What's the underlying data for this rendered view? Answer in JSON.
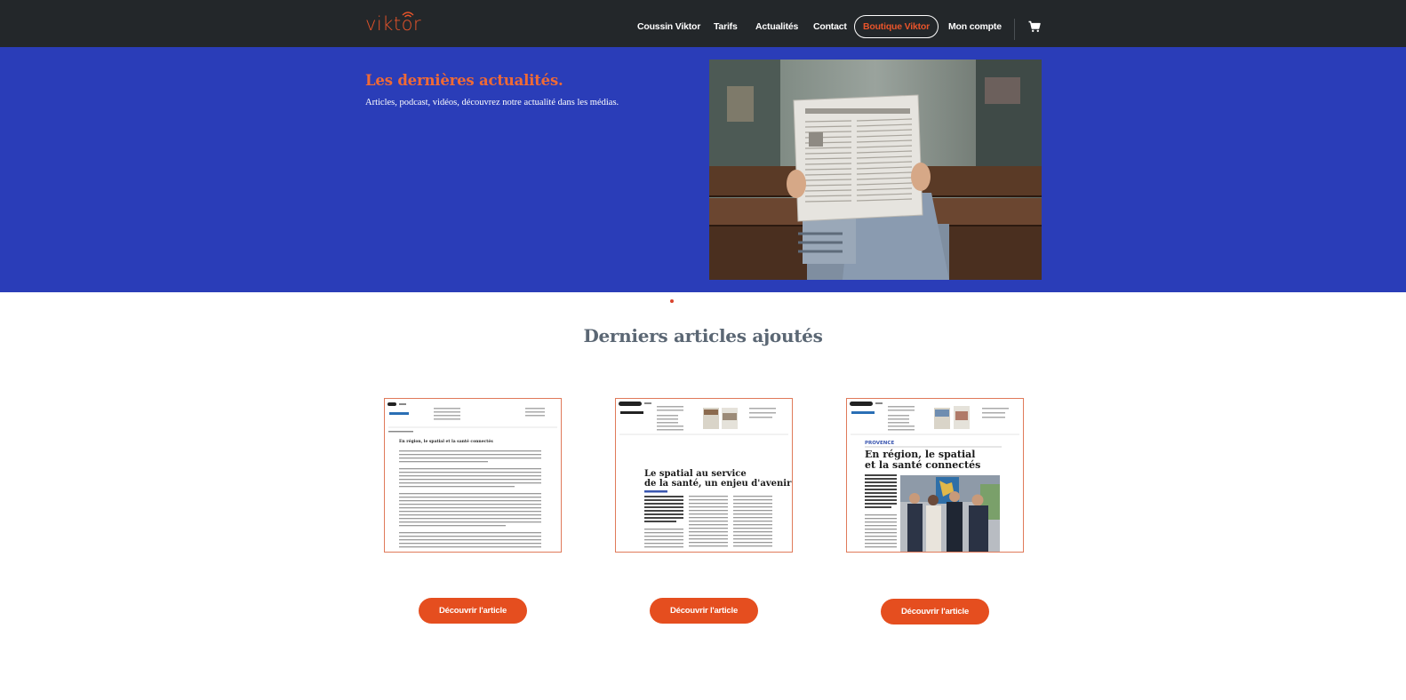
{
  "brand": {
    "logo_text": "viktor",
    "accent_color": "#e8542a",
    "header_bg": "#23272a",
    "hero_bg": "#2a3db8"
  },
  "nav": {
    "items": [
      "Coussin Viktor",
      "Tarifs",
      "Actualités",
      "Contact"
    ],
    "boutique": "Boutique Viktor",
    "account": "Mon compte",
    "cart_icon": "cart-icon"
  },
  "hero": {
    "title": "Les dernières actualités.",
    "subtitle": "Articles, podcast, vidéos, découvrez notre actualité dans les médias.",
    "image": "person-reading-newspaper-photo"
  },
  "section": {
    "title": "Derniers articles ajoutés"
  },
  "articles": [
    {
      "headline": "En région, le spatial et la santé connectés",
      "button": "Découvrir l'article"
    },
    {
      "headline": "Le spatial au service de la santé, un enjeu d'avenir",
      "button": "Découvrir l'article"
    },
    {
      "headline": "En région, le spatial et la santé connectés",
      "button": "Découvrir l'article"
    }
  ]
}
